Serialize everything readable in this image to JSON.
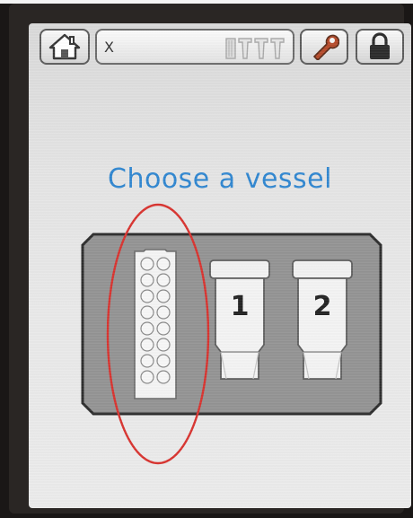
{
  "header": {
    "caption": ""
  },
  "toolbar": {
    "home_icon": "home-icon",
    "address_text": "X",
    "tips_icon": "tip-rack-icon",
    "settings_icon": "wrench-icon",
    "lock_icon": "lock-icon"
  },
  "main": {
    "title": "Choose a vessel",
    "vessels": [
      {
        "kind": "strip-plate",
        "label": ""
      },
      {
        "kind": "tube",
        "label": "1"
      },
      {
        "kind": "tube",
        "label": "2"
      }
    ],
    "selected_index": 0
  },
  "colors": {
    "title": "#2f86d0",
    "highlight_ring": "#d8322e",
    "panel": "#959595",
    "screen": "#e6e6e6"
  }
}
